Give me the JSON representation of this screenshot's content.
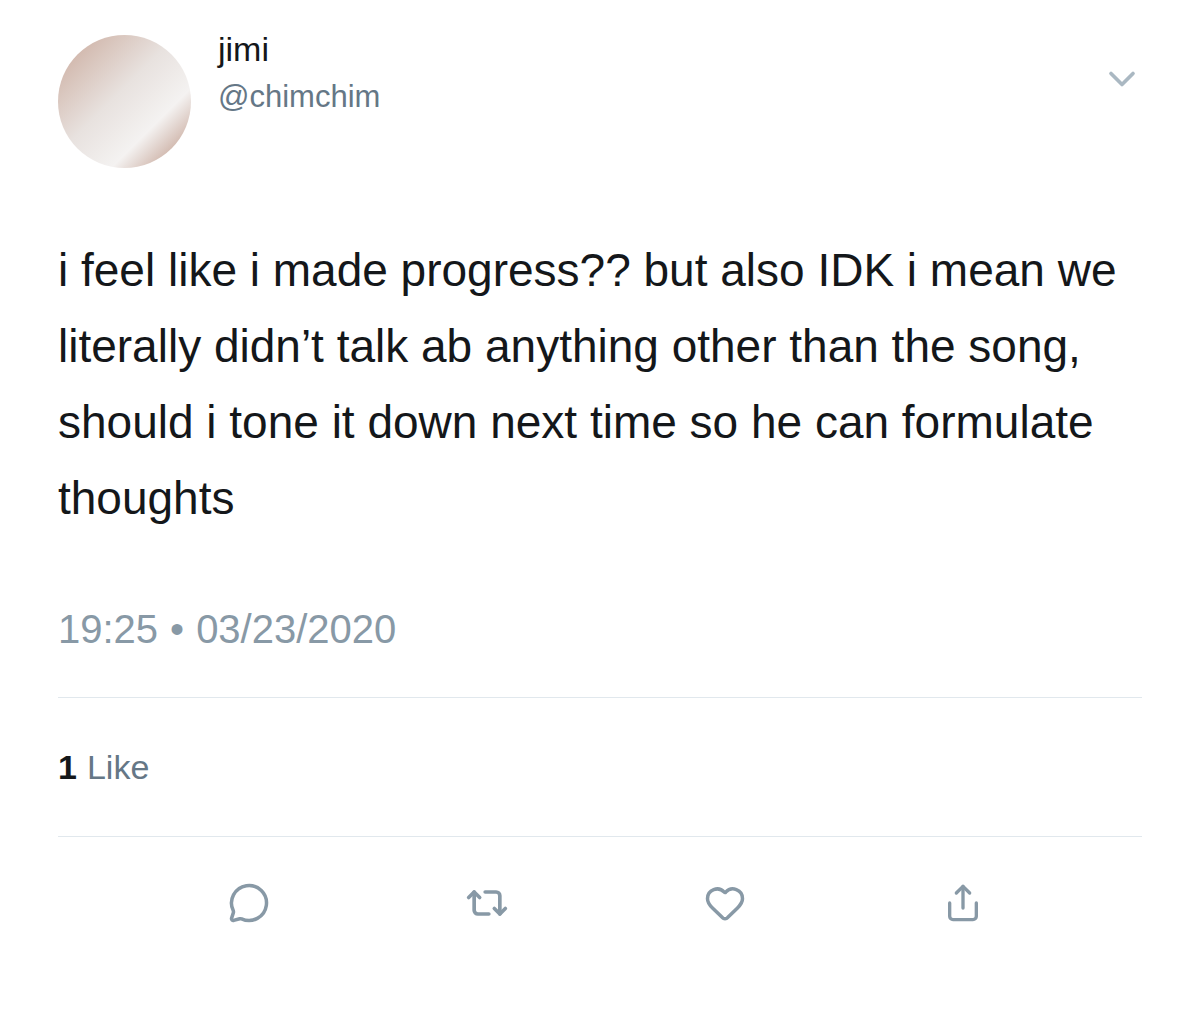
{
  "user": {
    "name": "jimi",
    "handle": "@chimchim"
  },
  "tweet": {
    "text": "i feel like i made progress?? but also IDK i mean we literally didn’t talk ab anything other than the song, should i tone it down next time so he can formulate thoughts",
    "time": "19:25",
    "separator": "•",
    "date": "03/23/2020"
  },
  "stats": {
    "likes_count": "1",
    "likes_label": "Like"
  }
}
